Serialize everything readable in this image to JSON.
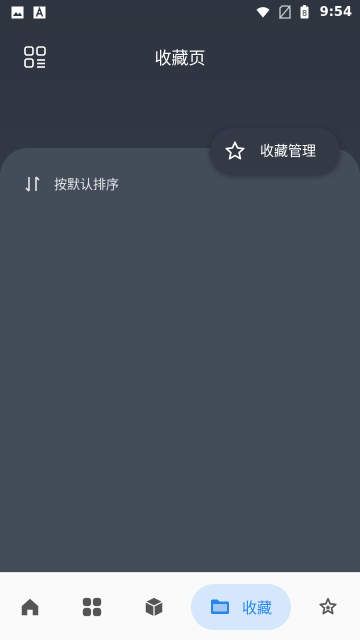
{
  "status_bar": {
    "time": "9:54",
    "battery_level": "8",
    "icons": [
      "image-icon",
      "font-icon",
      "wifi-icon",
      "no-sim-icon",
      "battery-icon"
    ]
  },
  "header": {
    "title": "收藏页",
    "menu_icon": "grid-list-icon"
  },
  "content": {
    "sort_label": "按默认排序",
    "sort_icon": "sort-icon"
  },
  "fab": {
    "label": "收藏管理",
    "icon": "star-icon"
  },
  "bottom_nav": {
    "items": [
      {
        "icon": "home-icon"
      },
      {
        "icon": "apps-icon"
      },
      {
        "icon": "cube-icon"
      },
      {
        "icon": "folder-icon",
        "label": "收藏",
        "active": true
      },
      {
        "icon": "star-sparkle-icon"
      }
    ]
  },
  "colors": {
    "background": "#2e3540",
    "card": "#434c59",
    "active_nav_bg": "#d5e8fb",
    "active_nav_fg": "#2a86e6",
    "nav_icon": "#555555"
  }
}
